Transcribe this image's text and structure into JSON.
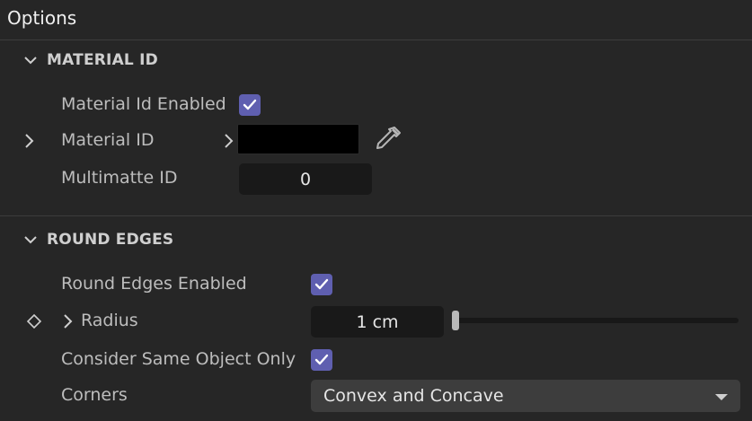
{
  "panel": {
    "title": "Options"
  },
  "material_id_section": {
    "header": "MATERIAL ID",
    "material_id_enabled_label": "Material Id Enabled",
    "material_id_enabled_checked": true,
    "material_id_label": "Material ID",
    "material_id_color": "#000000",
    "multimatte_label": "Multimatte ID",
    "multimatte_value": "0"
  },
  "round_edges_section": {
    "header": "ROUND EDGES",
    "round_edges_enabled_label": "Round Edges Enabled",
    "round_edges_enabled_checked": true,
    "radius_label": "Radius",
    "radius_value": "1 cm",
    "radius_slider_fraction": 0,
    "consider_same_label": "Consider Same Object Only",
    "consider_same_checked": true,
    "corners_label": "Corners",
    "corners_value": "Convex and Concave"
  },
  "colors": {
    "accent": "#5f5fb0",
    "background": "#262626",
    "field": "#191919",
    "dropdown": "#3d3d3d"
  }
}
